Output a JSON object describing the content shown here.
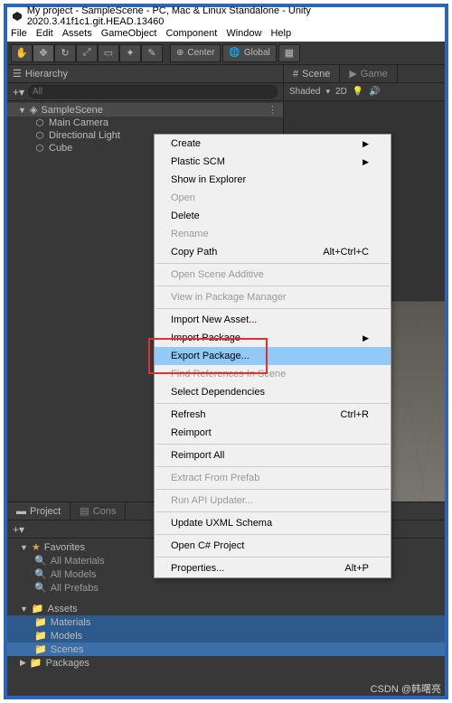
{
  "titlebar": {
    "title": "My project - SampleScene - PC, Mac & Linux Standalone - Unity 2020.3.41f1c1.git.HEAD.13460"
  },
  "menubar": {
    "items": [
      "File",
      "Edit",
      "Assets",
      "GameObject",
      "Component",
      "Window",
      "Help"
    ]
  },
  "toolbar": {
    "center_label": "Center",
    "global_label": "Global"
  },
  "hierarchy": {
    "tab_label": "Hierarchy",
    "search_placeholder": "All",
    "scene": "SampleScene",
    "items": [
      "Main Camera",
      "Directional Light",
      "Cube"
    ]
  },
  "scene_panel": {
    "tabs": [
      "Scene",
      "Game"
    ],
    "shading_mode": "Shaded",
    "toggle_2d": "2D"
  },
  "project": {
    "tabs": [
      "Project",
      "Cons"
    ],
    "favorites_label": "Favorites",
    "favorites": [
      "All Materials",
      "All Models",
      "All Prefabs"
    ],
    "assets_label": "Assets",
    "asset_folders": [
      "Materials",
      "Models",
      "Scenes"
    ],
    "packages_label": "Packages"
  },
  "context_menu": {
    "items": [
      {
        "label": "Create",
        "arrow": true
      },
      {
        "label": "Plastic SCM",
        "arrow": true
      },
      {
        "label": "Show in Explorer"
      },
      {
        "label": "Open",
        "disabled": true
      },
      {
        "label": "Delete"
      },
      {
        "label": "Rename",
        "disabled": true
      },
      {
        "label": "Copy Path",
        "shortcut": "Alt+Ctrl+C"
      },
      {
        "sep": true
      },
      {
        "label": "Open Scene Additive",
        "disabled": true
      },
      {
        "sep": true
      },
      {
        "label": "View in Package Manager",
        "disabled": true
      },
      {
        "sep": true
      },
      {
        "label": "Import New Asset..."
      },
      {
        "label": "Import Package",
        "arrow": true
      },
      {
        "label": "Export Package...",
        "highlighted": true
      },
      {
        "label": "Find References In Scene",
        "disabled": true
      },
      {
        "label": "Select Dependencies"
      },
      {
        "sep": true
      },
      {
        "label": "Refresh",
        "shortcut": "Ctrl+R"
      },
      {
        "label": "Reimport"
      },
      {
        "sep": true
      },
      {
        "label": "Reimport All"
      },
      {
        "sep": true
      },
      {
        "label": "Extract From Prefab",
        "disabled": true
      },
      {
        "sep": true
      },
      {
        "label": "Run API Updater...",
        "disabled": true
      },
      {
        "sep": true
      },
      {
        "label": "Update UXML Schema"
      },
      {
        "sep": true
      },
      {
        "label": "Open C# Project"
      },
      {
        "sep": true
      },
      {
        "label": "Properties...",
        "shortcut": "Alt+P"
      }
    ]
  },
  "watermark": "CSDN @韩曙亮"
}
